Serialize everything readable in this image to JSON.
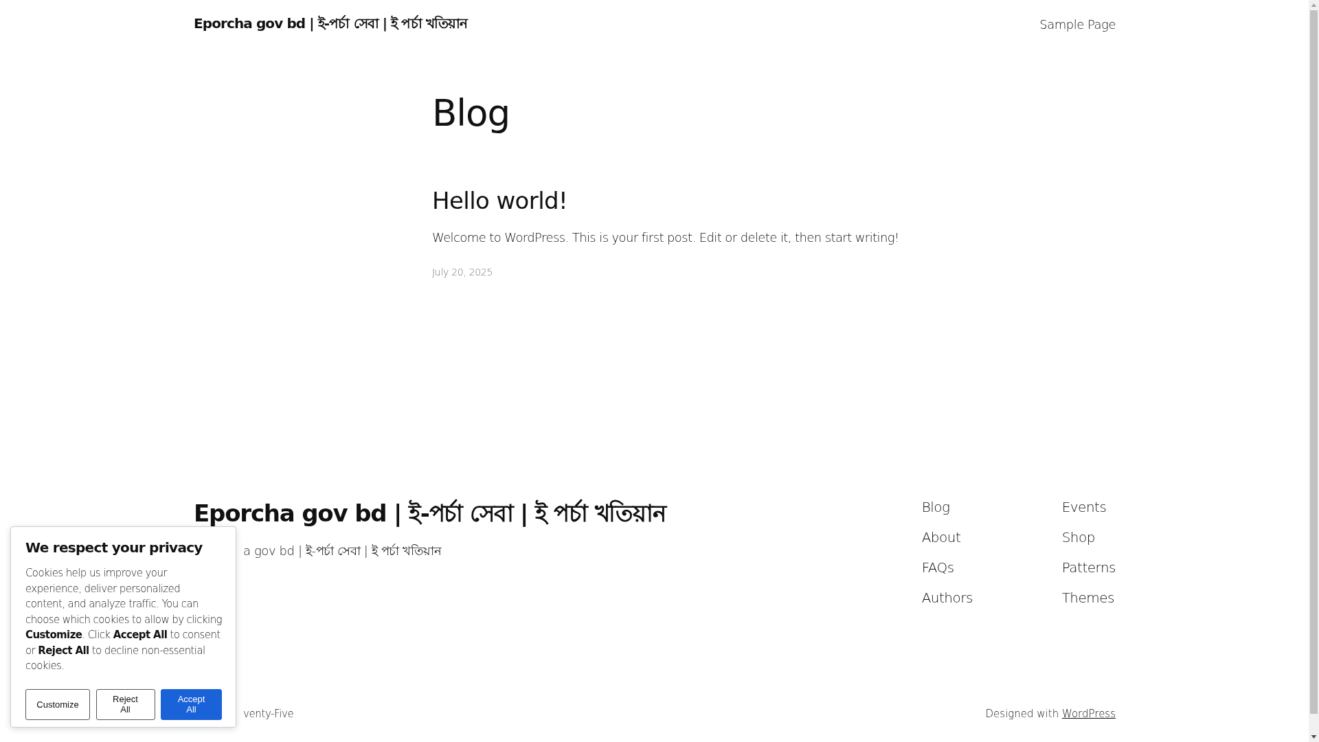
{
  "header": {
    "site_title": "Eporcha gov bd | ই-পর্চা সেবা | ই পর্চা খতিয়ান",
    "nav": [
      "Sample Page"
    ]
  },
  "main": {
    "heading": "Blog",
    "posts": [
      {
        "title": "Hello world!",
        "excerpt": "Welcome to WordPress. This is your first post. Edit or delete it, then start writing!",
        "date": "July 20, 2025"
      }
    ]
  },
  "footer": {
    "site_title": "Eporcha gov bd | ই-পর্চা সেবা | ই পর্চা খতিয়ান",
    "tagline": "a gov bd | ই-পর্চা সেবা | ই পর্চা খতিয়ান",
    "nav_columns": [
      [
        "Blog",
        "About",
        "FAQs",
        "Authors"
      ],
      [
        "Events",
        "Shop",
        "Patterns",
        "Themes"
      ]
    ],
    "theme_credit": "venty-Five",
    "credit_prefix": "Designed with",
    "credit_link": "WordPress"
  },
  "cookie_dialog": {
    "title": "We respect your privacy",
    "text": "Cookies help us improve your experience, deliver personalized content, and analyze traffic. You can choose which cookies to allow by clicking **Customize**. Click **Accept All** to consent or **Reject All** to decline non-essential cookies.",
    "buttons": [
      {
        "label": "Customize",
        "kind": "outline"
      },
      {
        "label": "Reject All",
        "kind": "outline"
      },
      {
        "label": "Accept All",
        "kind": "primary"
      }
    ]
  }
}
